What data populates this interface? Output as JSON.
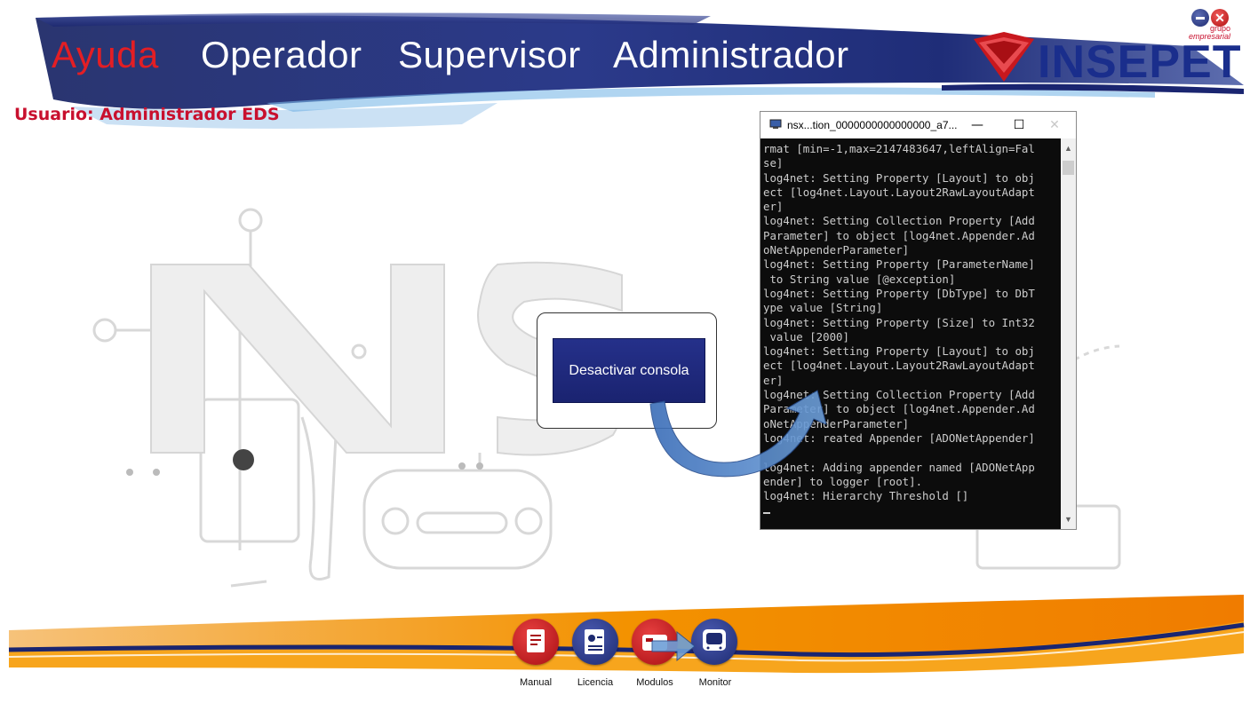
{
  "header": {
    "nav": [
      {
        "label": "Ayuda",
        "active": true
      },
      {
        "label": "Operador",
        "active": false
      },
      {
        "label": "Supervisor",
        "active": false
      },
      {
        "label": "Administrador",
        "active": false
      }
    ],
    "user_label": "Usuario: Administrador EDS",
    "logo": {
      "brand": "INSEPET",
      "small_line1": "grupo",
      "small_line2": "empresarial"
    }
  },
  "window_controls": {
    "minimize_icon": "minimize-circle-icon",
    "close_icon": "close-circle-icon"
  },
  "center": {
    "button_label": "Desactivar consola"
  },
  "console": {
    "title": "nsx...tion_0000000000000000_a7...",
    "lines": [
      "rmat [min=-1,max=2147483647,leftAlign=Fal",
      "se]",
      "log4net: Setting Property [Layout] to obj",
      "ect [log4net.Layout.Layout2RawLayoutAdapt",
      "er]",
      "log4net: Setting Collection Property [Add",
      "Parameter] to object [log4net.Appender.Ad",
      "oNetAppenderParameter]",
      "log4net: Setting Property [ParameterName]",
      " to String value [@exception]",
      "log4net: Setting Property [DbType] to DbT",
      "ype value [String]",
      "log4net: Setting Property [Size] to Int32",
      " value [2000]",
      "log4net: Setting Property [Layout] to obj",
      "ect [log4net.Layout.Layout2RawLayoutAdapt",
      "er]",
      "log4net: Setting Collection Property [Add",
      "Parameter] to object [log4net.Appender.Ad",
      "oNetAppenderParameter]",
      "log4net: reated Appender [ADONetAppender]",
      "",
      "log4net: Adding appender named [ADONetApp",
      "ender] to logger [root].",
      "log4net: Hierarchy Threshold []"
    ]
  },
  "bottom_bar": {
    "items": [
      {
        "label": "Manual",
        "icon": "manual-icon",
        "color": "#c8181e"
      },
      {
        "label": "Licencia",
        "icon": "license-icon",
        "color": "#23307c"
      },
      {
        "label": "Modulos",
        "icon": "modules-icon",
        "color": "#c8181e"
      },
      {
        "label": "Monitor",
        "icon": "monitor-icon",
        "color": "#23307c"
      }
    ]
  },
  "colors": {
    "brand_blue": "#1a2e8c",
    "brand_red": "#e31e24",
    "accent_orange": "#f39200"
  }
}
